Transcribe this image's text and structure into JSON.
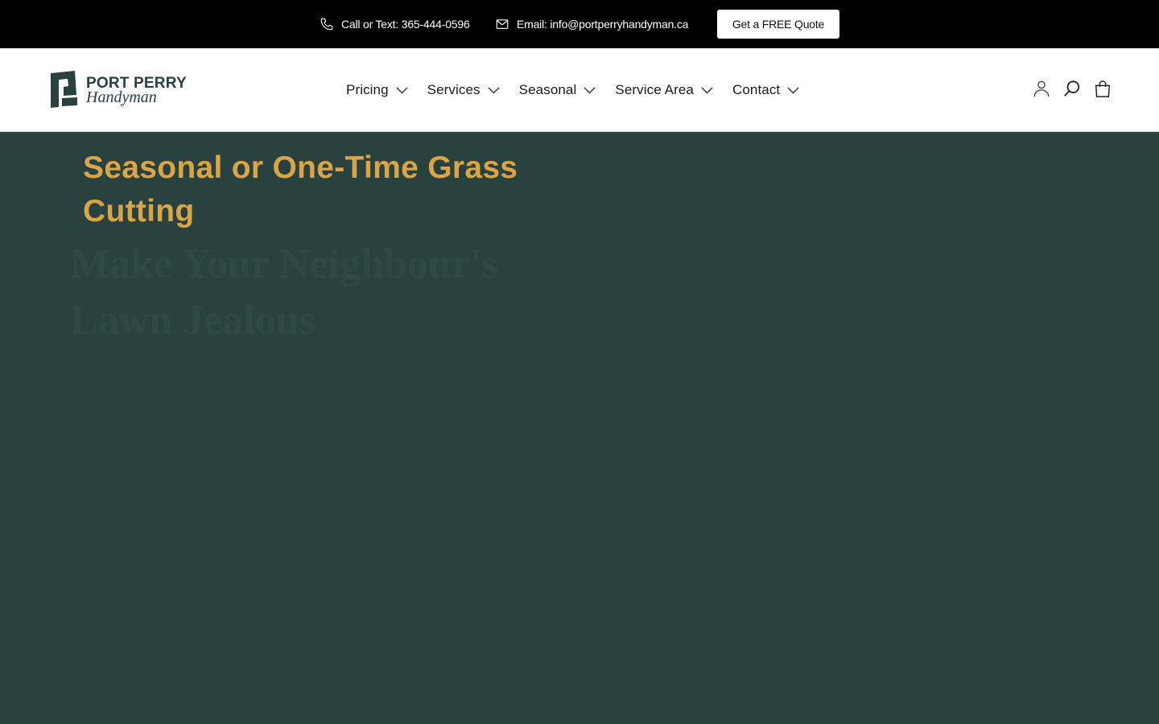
{
  "topbar": {
    "phone_label": "Call or Text: 365-444-0596",
    "email_label": "Email: info@portperryhandyman.ca",
    "quote_button": "Get a FREE Quote"
  },
  "logo": {
    "line1": "PORT PERRY",
    "line2": "Handyman"
  },
  "nav": {
    "items": [
      {
        "label": "Pricing"
      },
      {
        "label": "Services"
      },
      {
        "label": "Seasonal"
      },
      {
        "label": "Service Area"
      },
      {
        "label": "Contact"
      }
    ]
  },
  "header_icons": [
    "account-icon",
    "search-icon",
    "cart-icon"
  ],
  "hero": {
    "title": "Seasonal or One-Time Grass Cutting",
    "subtitle": "Make Your Neighbour's Lawn Jealous"
  },
  "colors": {
    "topbar_bg": "#000000",
    "brand_green": "#294240",
    "accent_gold": "#d9a547"
  }
}
